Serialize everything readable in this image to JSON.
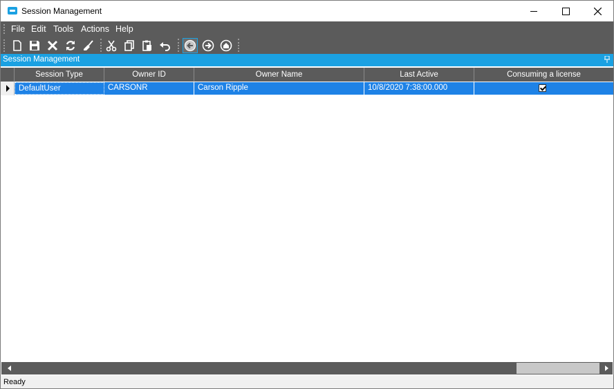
{
  "window": {
    "title": "Session Management"
  },
  "menu": [
    "File",
    "Edit",
    "Tools",
    "Actions",
    "Help"
  ],
  "toolbar": {
    "icons": [
      "new-icon",
      "save-icon",
      "delete-icon",
      "refresh-icon",
      "clear-icon",
      "cut-icon",
      "copy-icon",
      "paste-icon",
      "undo-icon",
      "back-icon",
      "forward-icon",
      "home-icon"
    ]
  },
  "panel": {
    "title": "Session Management"
  },
  "grid": {
    "columns": [
      "Session Type",
      "Owner ID",
      "Owner Name",
      "Last Active",
      "Consuming a license"
    ],
    "rows": [
      {
        "session_type": "DefaultUser",
        "owner_id": "CARSONR",
        "owner_name": "Carson Ripple",
        "last_active": "10/8/2020 7:38:00.000",
        "consuming_license": true
      }
    ]
  },
  "status": {
    "text": "Ready"
  },
  "colors": {
    "accent": "#1ba1e2",
    "selection": "#1e82e6",
    "chrome": "#5b5b5b"
  }
}
